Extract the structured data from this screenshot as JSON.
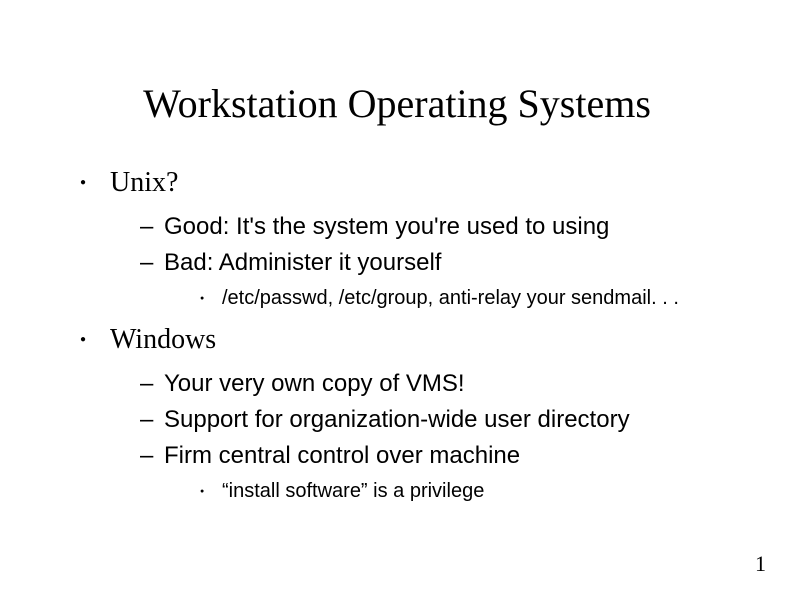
{
  "title": "Workstation Operating Systems",
  "page_number": "1",
  "bullets": [
    {
      "label": "Unix?",
      "sub": [
        {
          "label": "Good: It's the system you're used to using",
          "sub": []
        },
        {
          "label": "Bad: Administer it yourself",
          "sub": [
            {
              "label": "/etc/passwd, /etc/group, anti-relay your sendmail. . ."
            }
          ]
        }
      ]
    },
    {
      "label": "Windows",
      "sub": [
        {
          "label": "Your very own copy of VMS!",
          "sub": []
        },
        {
          "label": "Support for organization-wide user directory",
          "sub": []
        },
        {
          "label": "Firm central control over machine",
          "sub": [
            {
              "label": "“install software” is a privilege"
            }
          ]
        }
      ]
    }
  ]
}
